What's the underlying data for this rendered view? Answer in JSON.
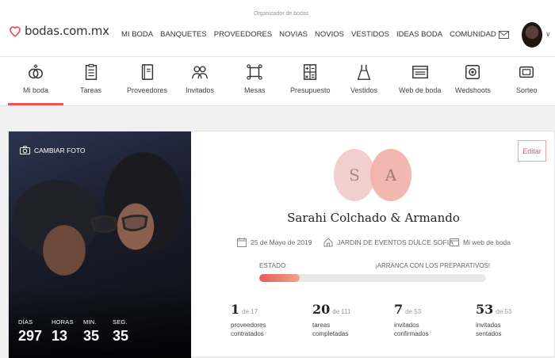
{
  "header": {
    "tagline": "Organizador de bodas",
    "logo_text": "bodas.com.mx",
    "nav": [
      "MI BODA",
      "BANQUETES",
      "PROVEEDORES",
      "NOVIAS",
      "NOVIOS",
      "VESTIDOS",
      "IDEAS BODA",
      "COMUNIDAD"
    ]
  },
  "icon_nav": [
    {
      "label": "Mi boda",
      "icon": "rings-icon"
    },
    {
      "label": "Tareas",
      "icon": "checklist-icon"
    },
    {
      "label": "Proveedores",
      "icon": "notebook-icon"
    },
    {
      "label": "Invitados",
      "icon": "guests-icon"
    },
    {
      "label": "Mesas",
      "icon": "table-icon"
    },
    {
      "label": "Presupuesto",
      "icon": "calculator-icon"
    },
    {
      "label": "Vestidos",
      "icon": "dress-icon"
    },
    {
      "label": "Web de boda",
      "icon": "website-icon"
    },
    {
      "label": "Wedshoots",
      "icon": "camera-icon"
    },
    {
      "label": "Sorteo",
      "icon": "ticket-icon"
    }
  ],
  "photo": {
    "change_label": "CAMBIAR FOTO",
    "countdown": [
      {
        "label": "DÍAS",
        "value": "297"
      },
      {
        "label": "HORAS",
        "value": "13"
      },
      {
        "label": "MIN.",
        "value": "35"
      },
      {
        "label": "SEG.",
        "value": "35"
      }
    ]
  },
  "profile": {
    "edit_label": "Editar",
    "initial_1": "S",
    "initial_2": "A",
    "names": "Sarahi Colchado & Armando",
    "date": "25 de Mayo de 2019",
    "venue": "JARDIN DE EVENTOS DULCE SOFIA",
    "web_link": "Mi web de boda",
    "status_label": "ESTADO:",
    "status_text": "¡ARRANCA CON LOS PREPARATIVOS!",
    "progress": 0.18
  },
  "stats": [
    {
      "value": "1",
      "of": "de 17",
      "desc": "proveedores contratados"
    },
    {
      "value": "20",
      "of": "de 111",
      "desc": "tareas completadas"
    },
    {
      "value": "7",
      "of": "de 53",
      "desc": "invitados confirmados"
    },
    {
      "value": "53",
      "of": "de 53",
      "desc": "invitados sentados"
    }
  ],
  "colors": {
    "accent": "#e55a5a",
    "initial_s": "#f0cdca",
    "initial_a": "#f2b0aa"
  }
}
